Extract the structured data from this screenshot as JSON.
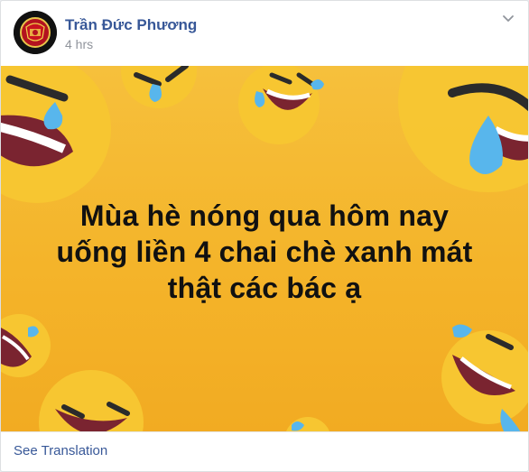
{
  "post": {
    "author_name": "Trần Đức Phương",
    "timestamp": "4 hrs",
    "menu_icon": "chevron-down-icon",
    "image": {
      "caption_lines": [
        "Mùa hè nóng qua hôm nay",
        "uống liền 4 chai chè xanh mát",
        "thật các bác ạ"
      ],
      "background_color": "#f4b42a"
    },
    "footer": {
      "see_translation_label": "See Translation"
    }
  },
  "colors": {
    "link": "#385898",
    "meta": "#90949c",
    "emoji_face": "#f7c631",
    "tear": "#4fb4ee"
  }
}
